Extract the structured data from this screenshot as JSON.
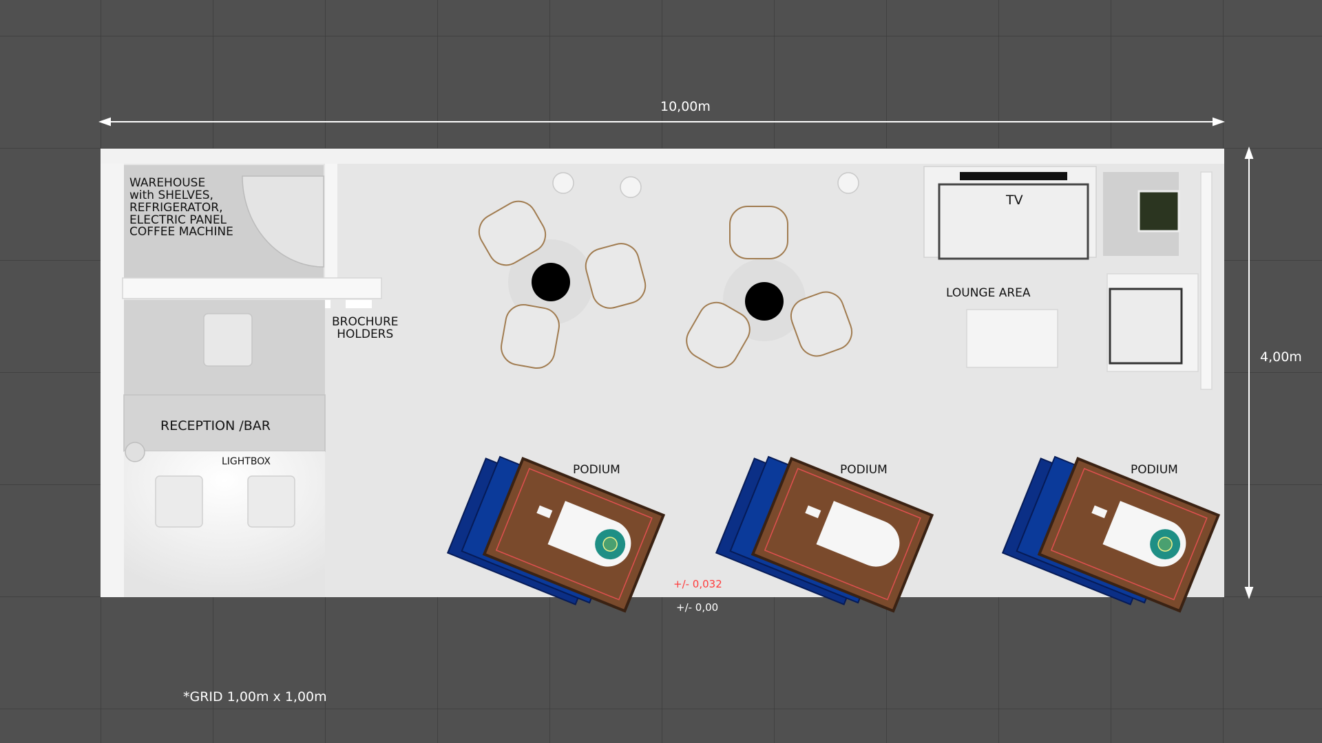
{
  "plan": {
    "width_label": "10,00m",
    "depth_label": "4,00m",
    "grid_note": "*GRID 1,00m x 1,00m",
    "level_top": "+/- 0,032",
    "level_base": "+/- 0,00"
  },
  "areas": {
    "warehouse": [
      "WAREHOUSE",
      "with SHELVES,",
      "REFRIGERATOR,",
      "ELECTRIC PANEL",
      "COFFEE MACHINE"
    ],
    "brochure": [
      "BROCHURE",
      "HOLDERS"
    ],
    "reception": "RECEPTION /BAR",
    "lightbox": "LIGHTBOX",
    "tv": "TV",
    "lounge": "LOUNGE AREA",
    "podium_1": "PODIUM",
    "podium_2": "PODIUM",
    "podium_3": "PODIUM"
  },
  "colors": {
    "background": "#505050",
    "floor": "#e6e6e6",
    "carpet": "#0b2f86",
    "podium_wood": "#7a4a2c",
    "level_text": "#ff3b3b"
  }
}
